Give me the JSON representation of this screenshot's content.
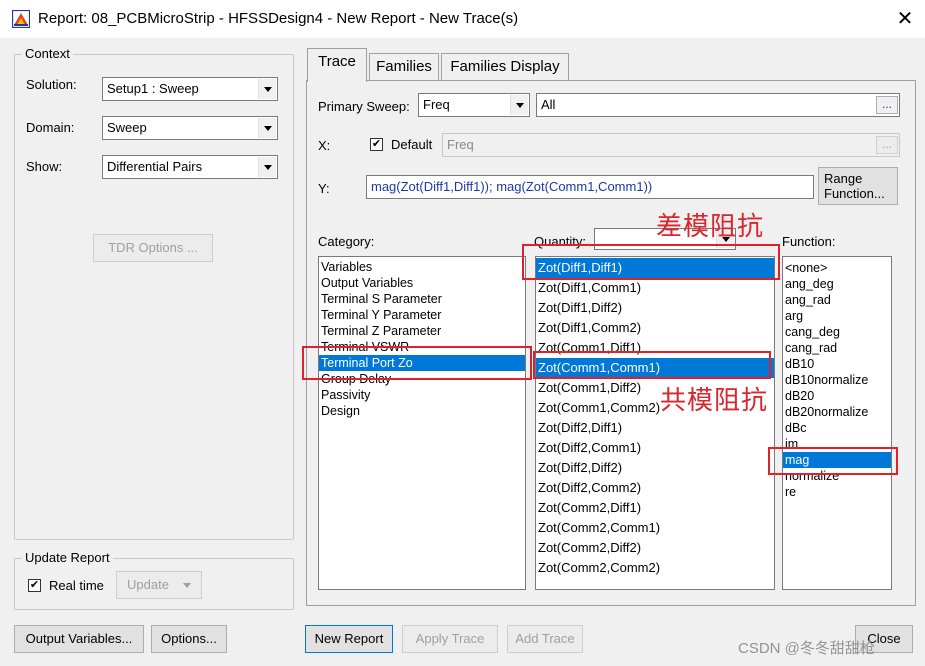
{
  "window": {
    "title": "Report: 08_PCBMicroStrip - HFSSDesign4 - New Report - New Trace(s)",
    "close_glyph": "✕"
  },
  "context": {
    "legend": "Context",
    "solution_label": "Solution:",
    "solution_value": "Setup1 : Sweep",
    "domain_label": "Domain:",
    "domain_value": "Sweep",
    "show_label": "Show:",
    "show_value": "Differential Pairs",
    "tdr_button": "TDR Options ..."
  },
  "update_report": {
    "legend": "Update Report",
    "realtime_label": "Real time",
    "realtime_checked": true,
    "update_button": "Update"
  },
  "bottom_left": {
    "output_variables": "Output Variables...",
    "options": "Options..."
  },
  "tabs": [
    {
      "label": "Trace",
      "active": true
    },
    {
      "label": "Families",
      "active": false
    },
    {
      "label": "Families Display",
      "active": false
    }
  ],
  "trace": {
    "primary_sweep_label": "Primary Sweep:",
    "primary_sweep_value": "Freq",
    "sweep_range_value": "All",
    "ellipsis": "...",
    "x_label": "X:",
    "default_label": "Default",
    "default_checked": true,
    "x_value": "Freq",
    "y_label": "Y:",
    "y_value": "mag(Zot(Diff1,Diff1)); mag(Zot(Comm1,Comm1))",
    "range_function_line1": "Range",
    "range_function_line2": "Function...",
    "category_label": "Category:",
    "quantity_label": "Quantity:",
    "function_label": "Function:"
  },
  "categories": [
    {
      "label": "Variables",
      "selected": false
    },
    {
      "label": "Output Variables",
      "selected": false
    },
    {
      "label": "Terminal S Parameter",
      "selected": false
    },
    {
      "label": "Terminal Y Parameter",
      "selected": false
    },
    {
      "label": "Terminal Z Parameter",
      "selected": false
    },
    {
      "label": "Terminal VSWR",
      "selected": false
    },
    {
      "label": "Terminal Port Zo",
      "selected": true
    },
    {
      "label": "Group Delay",
      "selected": false
    },
    {
      "label": "Passivity",
      "selected": false
    },
    {
      "label": "Design",
      "selected": false
    }
  ],
  "quantities": [
    {
      "label": "Zot(Diff1,Diff1)",
      "selected": true
    },
    {
      "label": "Zot(Diff1,Comm1)",
      "selected": false
    },
    {
      "label": "Zot(Diff1,Diff2)",
      "selected": false
    },
    {
      "label": "Zot(Diff1,Comm2)",
      "selected": false
    },
    {
      "label": "Zot(Comm1,Diff1)",
      "selected": false
    },
    {
      "label": "Zot(Comm1,Comm1)",
      "selected": true
    },
    {
      "label": "Zot(Comm1,Diff2)",
      "selected": false
    },
    {
      "label": "Zot(Comm1,Comm2)",
      "selected": false
    },
    {
      "label": "Zot(Diff2,Diff1)",
      "selected": false
    },
    {
      "label": "Zot(Diff2,Comm1)",
      "selected": false
    },
    {
      "label": "Zot(Diff2,Diff2)",
      "selected": false
    },
    {
      "label": "Zot(Diff2,Comm2)",
      "selected": false
    },
    {
      "label": "Zot(Comm2,Diff1)",
      "selected": false
    },
    {
      "label": "Zot(Comm2,Comm1)",
      "selected": false
    },
    {
      "label": "Zot(Comm2,Diff2)",
      "selected": false
    },
    {
      "label": "Zot(Comm2,Comm2)",
      "selected": false
    }
  ],
  "functions": [
    {
      "label": "<none>",
      "selected": false
    },
    {
      "label": "ang_deg",
      "selected": false
    },
    {
      "label": "ang_rad",
      "selected": false
    },
    {
      "label": "arg",
      "selected": false
    },
    {
      "label": "cang_deg",
      "selected": false
    },
    {
      "label": "cang_rad",
      "selected": false
    },
    {
      "label": "dB10",
      "selected": false
    },
    {
      "label": "dB10normalize",
      "selected": false
    },
    {
      "label": "dB20",
      "selected": false
    },
    {
      "label": "dB20normalize",
      "selected": false
    },
    {
      "label": "dBc",
      "selected": false
    },
    {
      "label": "im",
      "selected": false
    },
    {
      "label": "mag",
      "selected": true
    },
    {
      "label": "normalize",
      "selected": false
    },
    {
      "label": "re",
      "selected": false
    }
  ],
  "bottom_buttons": {
    "new_report": "New Report",
    "apply_trace": "Apply Trace",
    "add_trace": "Add Trace",
    "close": "Close"
  },
  "annotations": {
    "differential": "差模阻抗",
    "common": "共模阻抗",
    "color": "#d9252c"
  },
  "watermark": "CSDN @冬冬甜甜枪",
  "colors": {
    "selection": "#0078d7",
    "annotation": "#e0202a"
  }
}
